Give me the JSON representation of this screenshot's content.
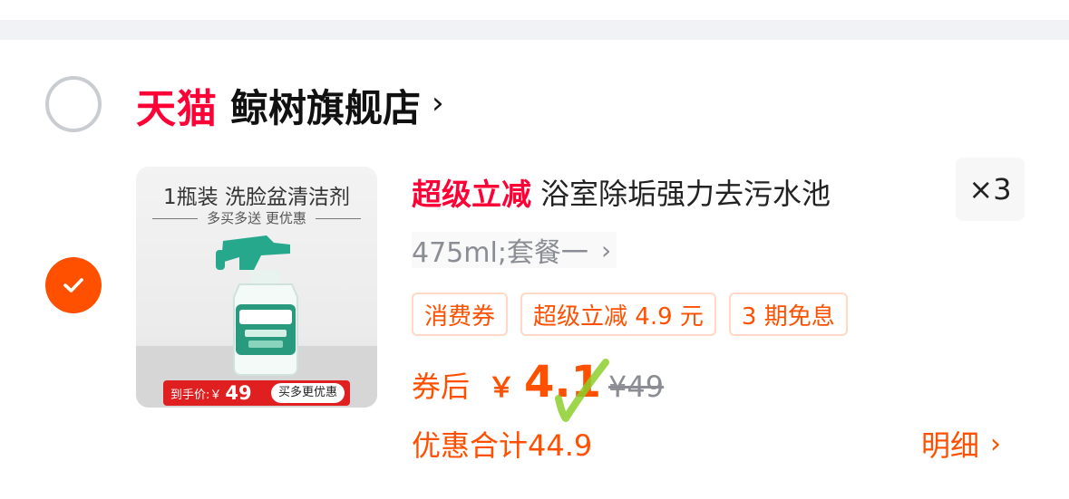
{
  "colors": {
    "accent": "#ff5000",
    "tmall_red": "#ff0036",
    "muted": "#8a8d93",
    "divider": "#f1f2f5"
  },
  "shop": {
    "platform_logo": "天猫",
    "name": "鲸树旗舰店",
    "chevron": "›",
    "selected": false
  },
  "item": {
    "selected": true,
    "thumbnail": {
      "title": "1瓶装 洗脸盆清洁剂",
      "subtitle": "多买多送 更优惠",
      "price_label": "到手价:￥",
      "price_value": "49",
      "promo_pill": "买多更优惠"
    },
    "promo_tag": "超级立减",
    "title": "浴室除垢强力去污水池",
    "quantity": "×3",
    "sku": "475ml;套餐一",
    "sku_chevron": "›",
    "tags": [
      "消费券",
      "超级立减 4.9 元",
      "3 期免息"
    ],
    "price_label": "券后",
    "currency": "￥",
    "price_int": "4.1",
    "price_dec": "",
    "original_price": "¥49",
    "discount_total": "优惠合计44.9",
    "detail_label": "明细",
    "detail_chevron": "›"
  },
  "icons": [
    "check-icon",
    "chevron-right-icon",
    "bottle-image",
    "green-check-mark"
  ]
}
